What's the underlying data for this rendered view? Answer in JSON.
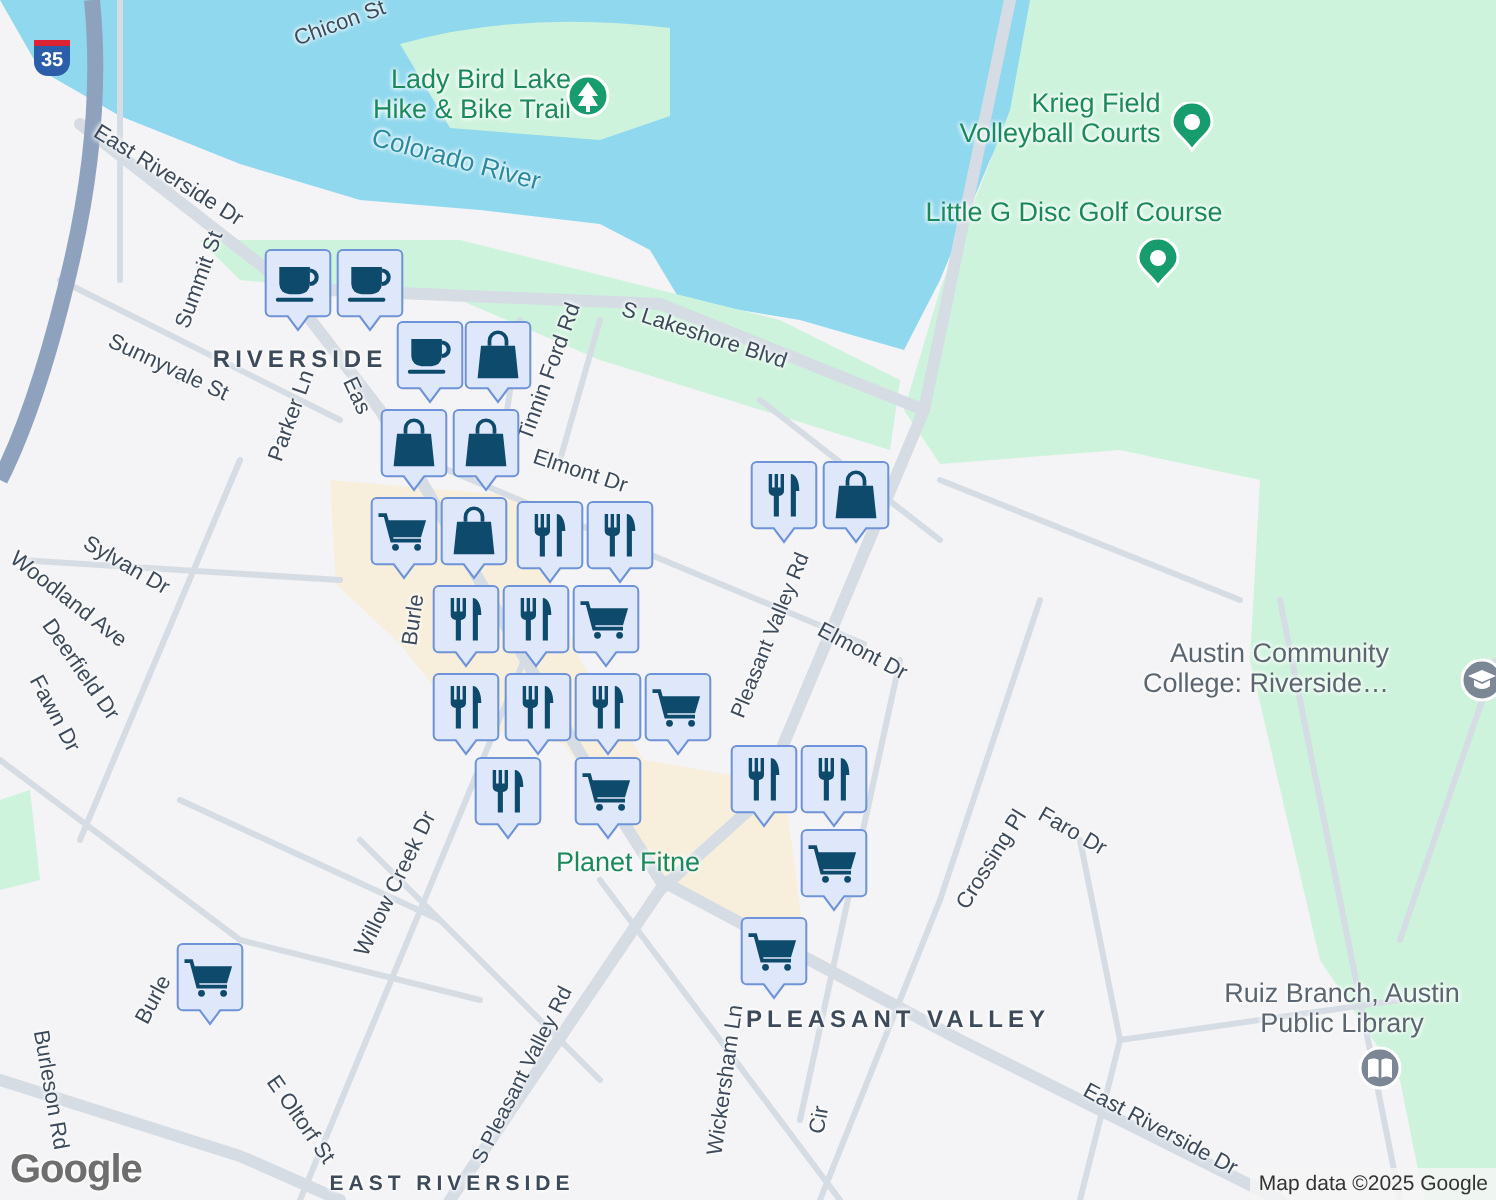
{
  "highway_shield": "35",
  "labels": [
    {
      "text": "Chicon St",
      "kind": "street"
    },
    {
      "text": "Lady Bird Lake\nHike & Bike Trail",
      "kind": "park"
    },
    {
      "text": "Colorado River",
      "kind": "water"
    },
    {
      "text": "East Riverside Dr",
      "kind": "street"
    },
    {
      "text": "Summit St",
      "kind": "street"
    },
    {
      "text": "Sunnyvale St",
      "kind": "street"
    },
    {
      "text": "RIVERSIDE",
      "kind": "area"
    },
    {
      "text": "Parker Ln",
      "kind": "street"
    },
    {
      "text": "Eas",
      "kind": "street"
    },
    {
      "text": "Tinnin Ford Rd",
      "kind": "street"
    },
    {
      "text": "S Lakeshore Blvd",
      "kind": "street"
    },
    {
      "text": "Elmont Dr",
      "kind": "street"
    },
    {
      "text": "Krieg Field\nVolleyball Courts",
      "kind": "park"
    },
    {
      "text": "Little G Disc Golf Course",
      "kind": "park"
    },
    {
      "text": "Sylvan Dr",
      "kind": "street"
    },
    {
      "text": "Woodland Ave",
      "kind": "street"
    },
    {
      "text": "Deerfield Dr",
      "kind": "street"
    },
    {
      "text": "Fawn Dr",
      "kind": "street"
    },
    {
      "text": "Burle",
      "kind": "street"
    },
    {
      "text": "Pleasant Valley Rd",
      "kind": "street"
    },
    {
      "text": "Elmont Dr",
      "kind": "street"
    },
    {
      "text": "Austin Community\nCollege: Riverside…",
      "kind": "place"
    },
    {
      "text": "Planet Fitne",
      "kind": "park"
    },
    {
      "text": "Willow Creek Dr",
      "kind": "street"
    },
    {
      "text": "Crossing Pl",
      "kind": "street"
    },
    {
      "text": "Faro Dr",
      "kind": "street"
    },
    {
      "text": "Burle",
      "kind": "street"
    },
    {
      "text": "Wickersham Ln",
      "kind": "street"
    },
    {
      "text": "PLEASANT VALLEY",
      "kind": "area"
    },
    {
      "text": "Ruiz Branch, Austin\nPublic Library",
      "kind": "place"
    },
    {
      "text": "Burleson Rd",
      "kind": "street"
    },
    {
      "text": "E Oltorf St",
      "kind": "street"
    },
    {
      "text": "S Pleasant Valley Rd",
      "kind": "street"
    },
    {
      "text": "Cir",
      "kind": "street"
    },
    {
      "text": "East Riverside Dr",
      "kind": "street"
    },
    {
      "text": "EAST RIVERSIDE",
      "kind": "area"
    }
  ],
  "poi_markers": [
    {
      "kind": "tree"
    },
    {
      "kind": "dot"
    },
    {
      "kind": "dot"
    },
    {
      "kind": "school"
    },
    {
      "kind": "book"
    }
  ],
  "pins": [
    {
      "kind": "cafe"
    },
    {
      "kind": "cafe"
    },
    {
      "kind": "cafe"
    },
    {
      "kind": "shopping"
    },
    {
      "kind": "shopping"
    },
    {
      "kind": "shopping"
    },
    {
      "kind": "grocery"
    },
    {
      "kind": "shopping"
    },
    {
      "kind": "restaurant"
    },
    {
      "kind": "restaurant"
    },
    {
      "kind": "grocery"
    },
    {
      "kind": "restaurant"
    },
    {
      "kind": "restaurant"
    },
    {
      "kind": "restaurant"
    },
    {
      "kind": "restaurant"
    },
    {
      "kind": "restaurant"
    },
    {
      "kind": "grocery"
    },
    {
      "kind": "grocery"
    },
    {
      "kind": "restaurant"
    },
    {
      "kind": "restaurant"
    },
    {
      "kind": "restaurant"
    },
    {
      "kind": "grocery"
    },
    {
      "kind": "restaurant"
    },
    {
      "kind": "shopping"
    },
    {
      "kind": "grocery"
    },
    {
      "kind": "grocery"
    }
  ],
  "logo": "Google",
  "attribution": "Map data ©2025 Google"
}
